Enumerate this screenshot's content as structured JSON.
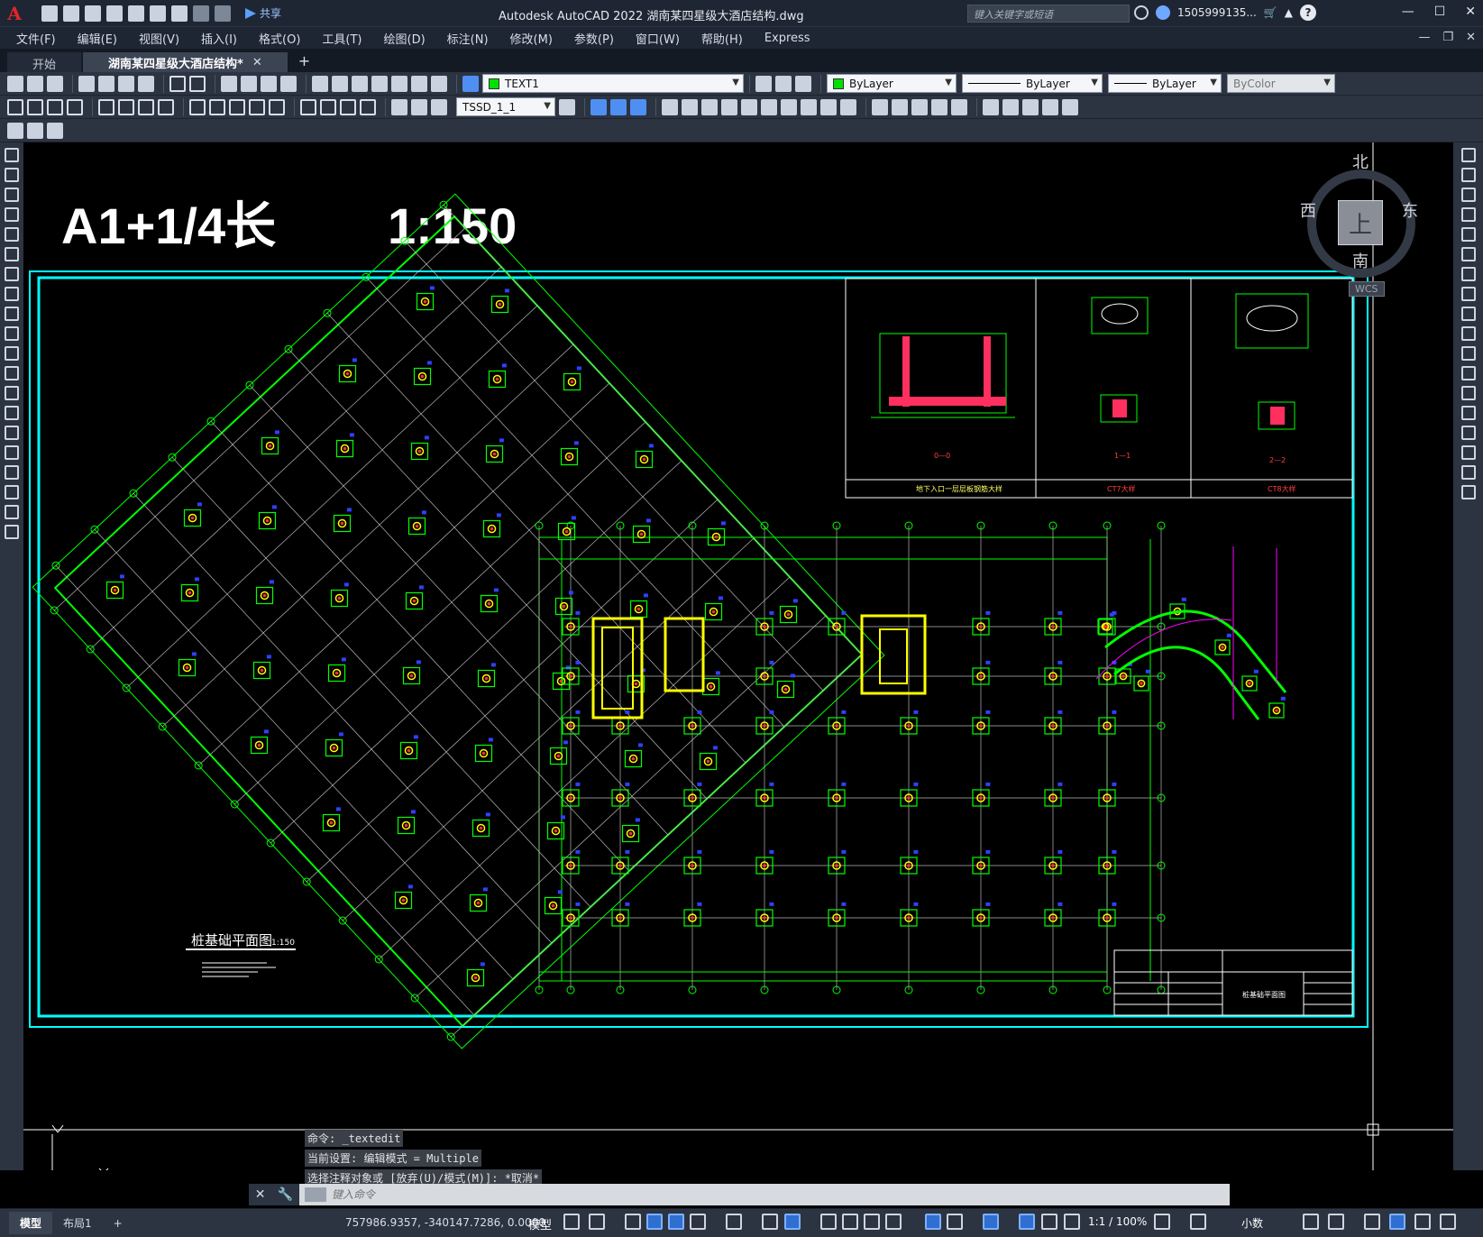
{
  "titlebar": {
    "logo": "A",
    "share_label": "共享",
    "app_title": "Autodesk AutoCAD 2022    湖南某四星级大酒店结构.dwg",
    "search_placeholder": "键入关键字或短语",
    "username": "1505999135...",
    "help": "?"
  },
  "menu": [
    "文件(F)",
    "编辑(E)",
    "视图(V)",
    "插入(I)",
    "格式(O)",
    "工具(T)",
    "绘图(D)",
    "标注(N)",
    "修改(M)",
    "参数(P)",
    "窗口(W)",
    "帮助(H)",
    "Express"
  ],
  "tabs": {
    "start": "开始",
    "active_doc": "湖南某四星级大酒店结构*",
    "close": "✕",
    "new": "+"
  },
  "toolbar": {
    "layer": "TEXT1",
    "color": "ByLayer",
    "linetype": "ByLayer",
    "lineweight": "ByLayer",
    "plotstyle": "ByColor",
    "dimstyle": "TSSD_1_1"
  },
  "drawing": {
    "heading_left": "A1+1/4长",
    "heading_right": "1:150",
    "plan_title": "桩基础平面图",
    "plan_scale": "1:150",
    "detail_label_1": "0—0",
    "detail_label_2": "1—1",
    "detail_label_3": "2—2",
    "detail_caption_1": "地下入口一层层板钢筋大样",
    "detail_caption_2": "CT7大样",
    "detail_caption_3": "CT8大样",
    "titleblock_name": "桩基础平面图"
  },
  "viewcube": {
    "north": "北",
    "south": "南",
    "east": "东",
    "west": "西",
    "top_face": "上",
    "wcs": "WCS"
  },
  "command": {
    "history": [
      "命令: _textedit",
      "当前设置: 编辑模式 = Multiple",
      "选择注释对象或 [放弃(U)/模式(M)]: *取消*"
    ],
    "placeholder": "键入命令"
  },
  "status": {
    "model_tab": "模型",
    "layout_tab": "布局1",
    "add_tab": "+",
    "coords": "757986.9357, -340147.7286, 0.0000",
    "space": "模型",
    "scale": "1:1 / 100%",
    "units": "小数"
  },
  "colors": {
    "frame_cyan": "#00ffff",
    "grid_green": "#00ff00",
    "column_yellow": "#ffff00",
    "pile_red": "#ff3030",
    "marker_blue": "#3040ff",
    "marker_magenta": "#ff40a0"
  }
}
